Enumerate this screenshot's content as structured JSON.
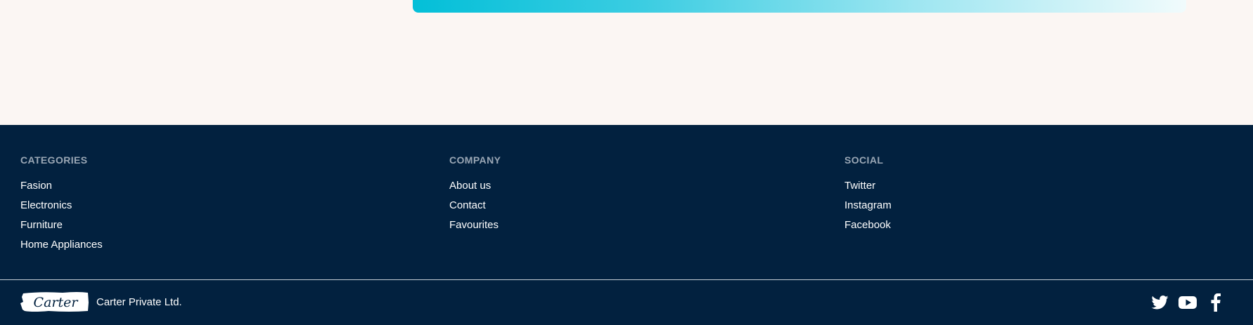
{
  "footer": {
    "categories": {
      "heading": "CATEGORIES",
      "links": [
        "Fasion",
        "Electronics",
        "Furniture",
        "Home Appliances"
      ]
    },
    "company": {
      "heading": "COMPANY",
      "links": [
        "About us",
        "Contact",
        "Favourites"
      ]
    },
    "social": {
      "heading": "SOCIAL",
      "links": [
        "Twitter",
        "Instagram",
        "Facebook"
      ]
    },
    "brand": {
      "logo_text": "Carter",
      "company_name": "Carter Private Ltd."
    },
    "social_icons": [
      "twitter-icon",
      "youtube-icon",
      "facebook-icon"
    ]
  },
  "colors": {
    "page_background": "#fbf6f3",
    "footer_background": "#02213f",
    "accent_gradient_start": "#03bfd8",
    "heading_text": "#9aa7b5",
    "link_text": "#ffffff"
  }
}
